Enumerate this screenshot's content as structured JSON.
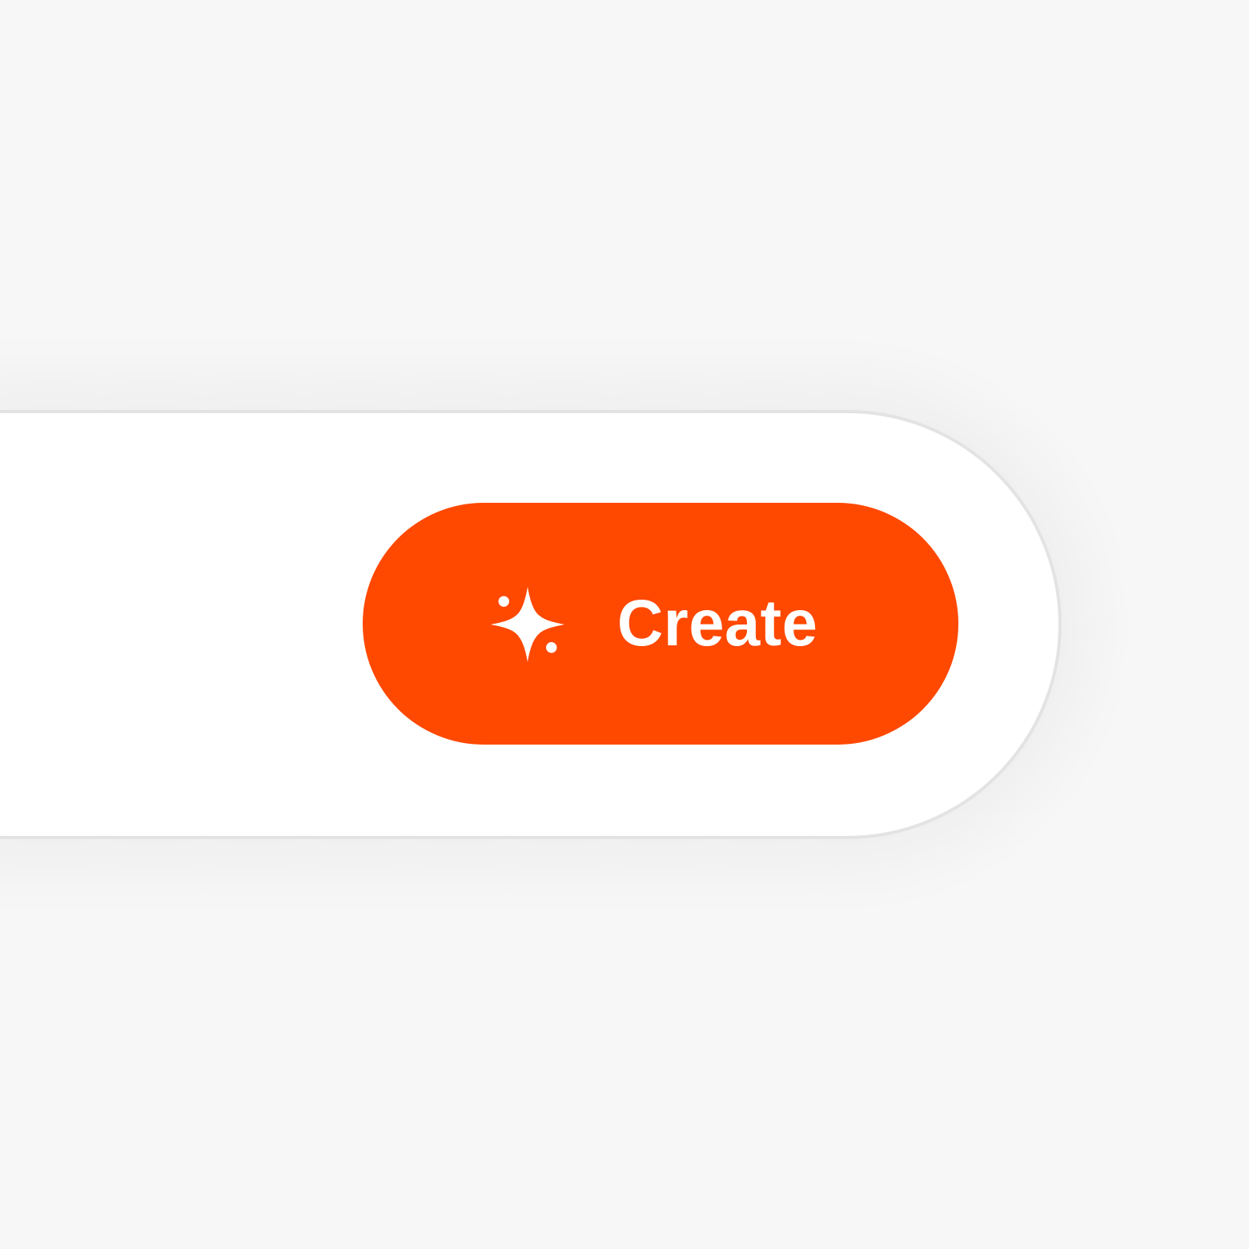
{
  "prompt_bar": {
    "create_button": {
      "label": "Create",
      "icon": "sparkle-icon"
    }
  },
  "colors": {
    "background": "#f7f7f7",
    "bar_background": "#ffffff",
    "bar_border": "#e3e3e3",
    "accent": "#ff4800",
    "button_text": "#ffffff"
  }
}
